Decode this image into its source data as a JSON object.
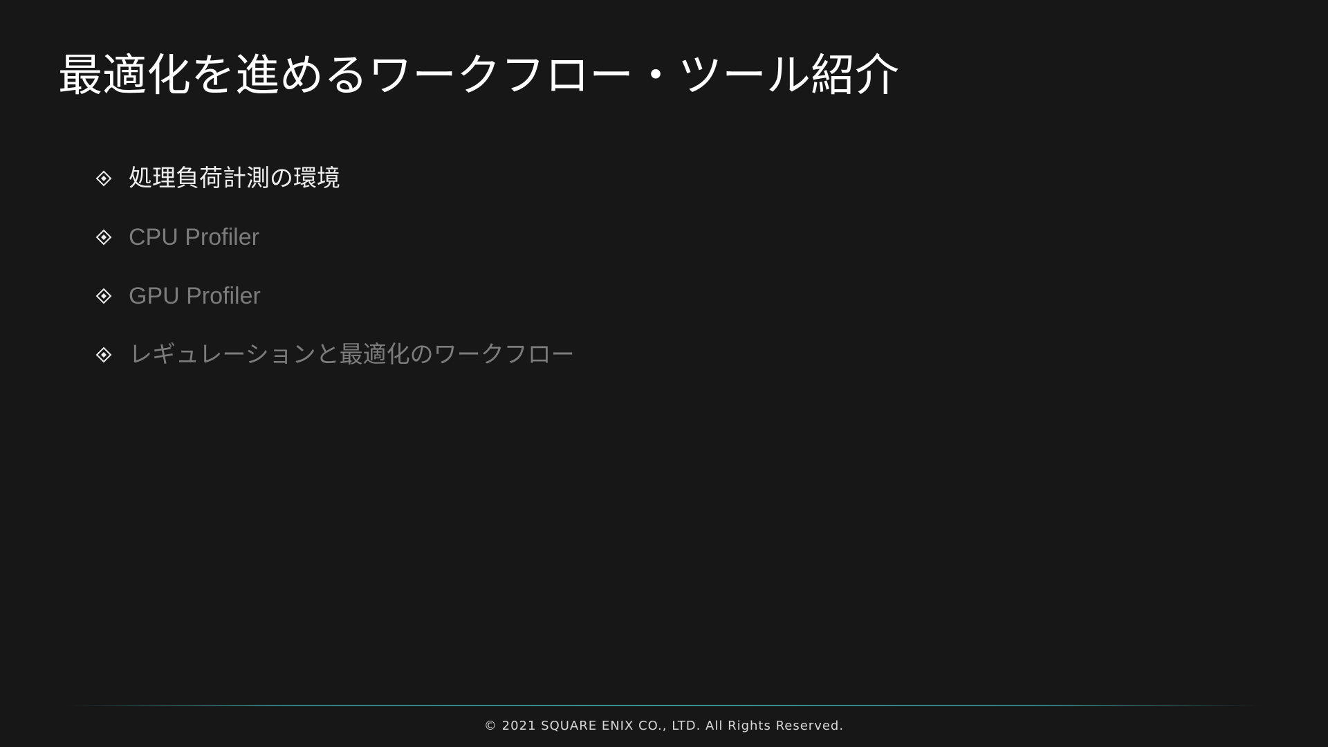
{
  "slide": {
    "title": "最適化を進めるワークフロー・ツール紹介",
    "agenda": [
      {
        "label": "処理負荷計測の環境",
        "state": "active"
      },
      {
        "label": "CPU Profiler",
        "state": "inactive"
      },
      {
        "label": "GPU Profiler",
        "state": "inactive"
      },
      {
        "label": "レギュレーションと最適化のワークフロー",
        "state": "inactive"
      }
    ],
    "bullet_icon": "diamond-bullet-icon",
    "colors": {
      "background": "#171717",
      "title": "#ffffff",
      "active_text": "#eeeeee",
      "inactive_text": "#7c7c7c",
      "accent_line": "#3a9490"
    }
  },
  "footer": {
    "copyright": "© 2021 SQUARE ENIX CO., LTD. All Rights Reserved."
  }
}
